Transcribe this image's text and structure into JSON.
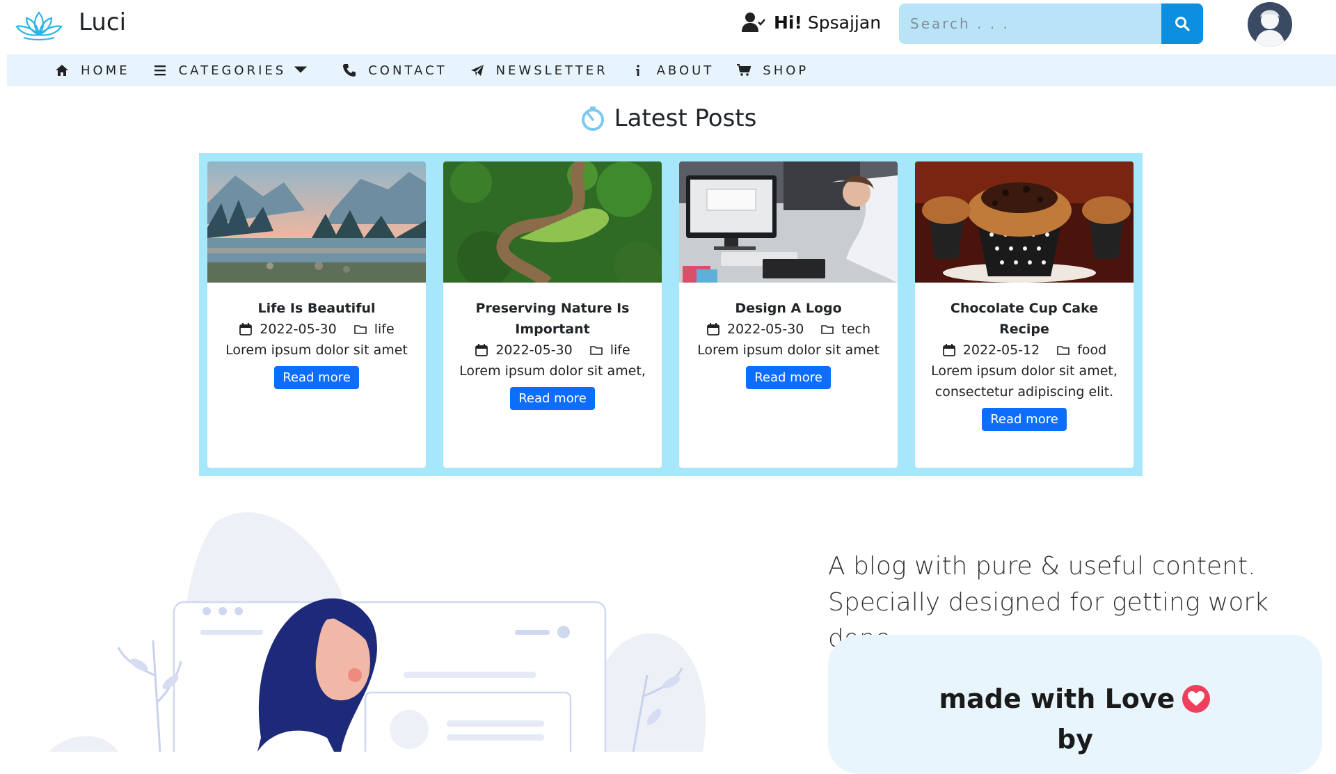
{
  "brand": {
    "name": "Luci",
    "logo": "lotus-logo"
  },
  "user": {
    "greeting": "Hi!",
    "name": "Spsajjan",
    "icon": "user-check-icon"
  },
  "search": {
    "placeholder": "Search . . .",
    "button_icon": "search-icon"
  },
  "nav": {
    "items": [
      {
        "label": "HOME",
        "icon": "home-icon"
      },
      {
        "label": "CATEGORIES",
        "icon": "list-icon",
        "dropdown": true
      },
      {
        "label": "CONTACT",
        "icon": "phone-icon"
      },
      {
        "label": "NEWSLETTER",
        "icon": "send-icon"
      },
      {
        "label": "ABOUT",
        "icon": "info-icon"
      },
      {
        "label": "SHOP",
        "icon": "cart-icon"
      }
    ]
  },
  "latest": {
    "title": "Latest Posts",
    "icon": "timer-icon",
    "posts": [
      {
        "title": "Life Is Beautiful",
        "date": "2022-05-30",
        "category": "life",
        "excerpt": "Lorem ipsum dolor sit amet",
        "button": "Read more"
      },
      {
        "title": "Preserving Nature Is Important",
        "date": "2022-05-30",
        "category": "life",
        "excerpt": "Lorem ipsum dolor sit amet,",
        "button": "Read more"
      },
      {
        "title": "Design A Logo",
        "date": "2022-05-30",
        "category": "tech",
        "excerpt": "Lorem ipsum dolor sit amet",
        "button": "Read more"
      },
      {
        "title": "Chocolate Cup Cake Recipe",
        "date": "2022-05-12",
        "category": "food",
        "excerpt": "Lorem ipsum dolor sit amet, consectetur adipiscing elit.",
        "button": "Read more"
      }
    ]
  },
  "hero": {
    "tagline": "A blog with pure & useful content. Specially designed for getting work done.",
    "made_with": "made with Love",
    "by": "by"
  },
  "colors": {
    "accent": "#0d6efd",
    "search_bg": "#b9e3f7",
    "search_button": "#0d8fe0",
    "nav_bg": "#e7f4fd",
    "posts_frame": "#a6e7fb",
    "heart": "#f03e5d"
  }
}
